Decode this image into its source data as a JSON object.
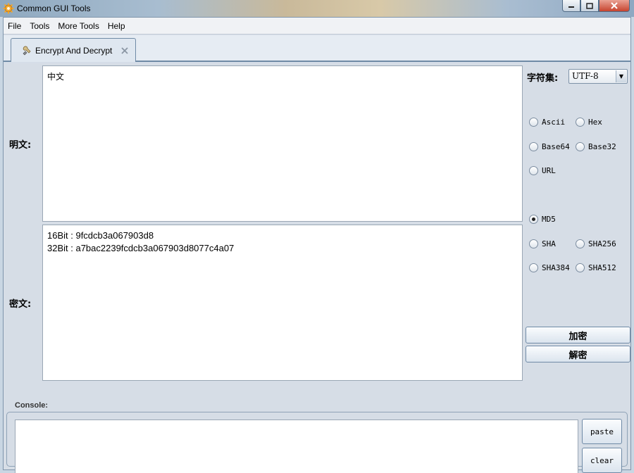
{
  "window": {
    "title": "Common GUI Tools"
  },
  "menu": {
    "items": [
      "File",
      "Tools",
      "More Tools",
      "Help"
    ]
  },
  "tabs": [
    {
      "label": "Encrypt And Decrypt"
    }
  ],
  "labels": {
    "plain": "明文:",
    "cipher": "密文:",
    "charset": "字符集:",
    "console": "Console:"
  },
  "plaintext": {
    "value": "中文"
  },
  "ciphertext": {
    "lines": [
      "16Bit : 9fcdcb3a067903d8",
      "32Bit : a7bac2239fcdcb3a067903d8077c4a07"
    ]
  },
  "charset": {
    "selected": "UTF-8"
  },
  "encodings": {
    "ascii": "Ascii",
    "hex": "Hex",
    "base64": "Base64",
    "base32": "Base32",
    "url": "URL"
  },
  "hashes": {
    "md5": "MD5",
    "sha": "SHA",
    "sha256": "SHA256",
    "sha384": "SHA384",
    "sha512": "SHA512",
    "selected": "MD5"
  },
  "buttons": {
    "encrypt": "加密",
    "decrypt": "解密",
    "paste": "paste",
    "clear": "clear"
  },
  "colors": {
    "accent": "#6f8aa6",
    "panel": "#d6dde6"
  }
}
